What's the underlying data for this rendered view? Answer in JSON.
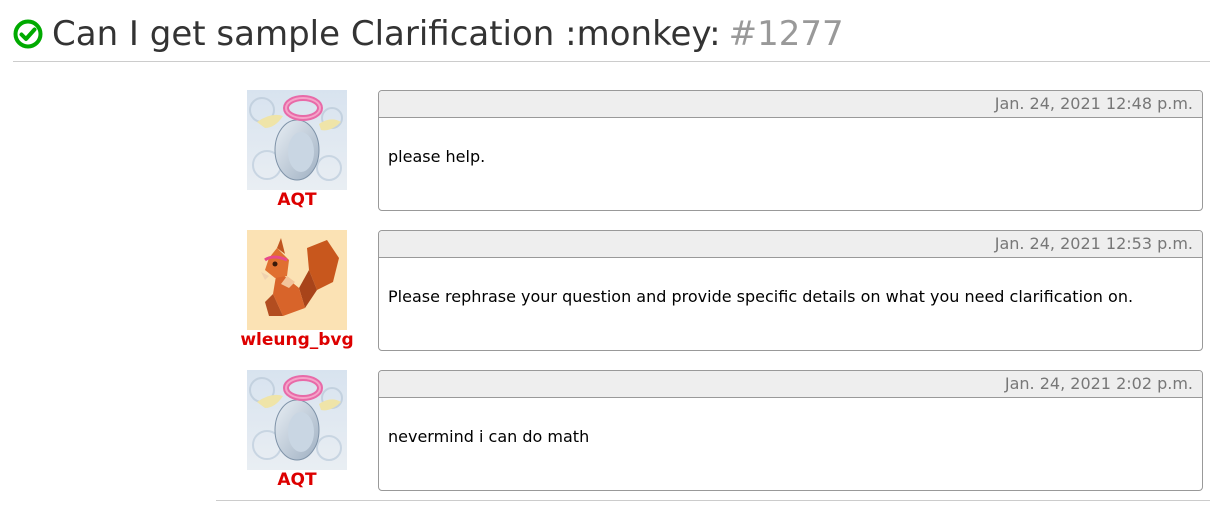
{
  "header": {
    "title": "Can I get sample Clarification :monkey:",
    "number": "#1277",
    "status_icon": "check-circle-icon",
    "status_color": "#00aa00"
  },
  "comments": [
    {
      "author": "AQT",
      "avatar": "angel-penguin-avatar",
      "timestamp": "Jan. 24, 2021 12:48 p.m.",
      "body": "please help."
    },
    {
      "author": "wleung_bvg",
      "avatar": "origami-squirrel-avatar",
      "timestamp": "Jan. 24, 2021 12:53 p.m.",
      "body": "Please rephrase your question and provide specific details on what you need clarification on."
    },
    {
      "author": "AQT",
      "avatar": "angel-penguin-avatar",
      "timestamp": "Jan. 24, 2021 2:02 p.m.",
      "body": "nevermind i can do math"
    }
  ],
  "colors": {
    "username": "#dd0000",
    "card_header_bg": "#eeeeee",
    "card_border": "#999999",
    "title_text": "#333333",
    "title_number": "#999999"
  }
}
